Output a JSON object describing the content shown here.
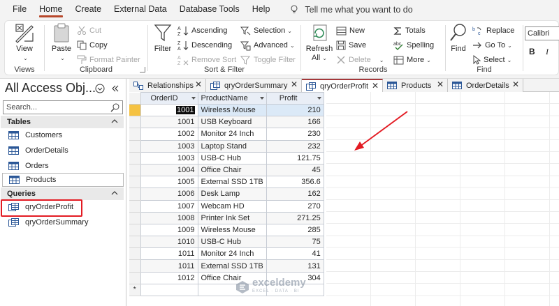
{
  "menu": {
    "items": [
      "File",
      "Home",
      "Create",
      "External Data",
      "Database Tools",
      "Help"
    ],
    "active": "Home",
    "tell_me": "Tell me what you want to do"
  },
  "ribbon": {
    "views": {
      "view_label": "View",
      "group_label": "Views"
    },
    "clipboard": {
      "paste_label": "Paste",
      "cut_label": "Cut",
      "copy_label": "Copy",
      "format_painter_label": "Format Painter",
      "group_label": "Clipboard"
    },
    "sort_filter": {
      "filter_label": "Filter",
      "ascending_label": "Ascending",
      "descending_label": "Descending",
      "remove_sort_label": "Remove Sort",
      "selection_label": "Selection",
      "advanced_label": "Advanced",
      "toggle_filter_label": "Toggle Filter",
      "group_label": "Sort & Filter"
    },
    "records": {
      "refresh_label": "Refresh",
      "refresh_sub": "All",
      "new_label": "New",
      "save_label": "Save",
      "delete_label": "Delete",
      "totals_label": "Totals",
      "spelling_label": "Spelling",
      "more_label": "More",
      "group_label": "Records"
    },
    "find": {
      "find_label": "Find",
      "replace_label": "Replace",
      "goto_label": "Go To",
      "select_label": "Select",
      "group_label": "Find"
    },
    "text_formatting": {
      "font_value": "Calibri",
      "bold_label": "B",
      "italic_label": "I"
    }
  },
  "nav": {
    "title": "All Access Obj...",
    "search_placeholder": "Search...",
    "tables_header": "Tables",
    "tables": [
      "Customers",
      "OrderDetails",
      "Orders",
      "Products"
    ],
    "selected_table": "Products",
    "queries_header": "Queries",
    "queries": [
      "qryOrderProfit",
      "qryOrderSummary"
    ]
  },
  "doc_tabs": [
    {
      "label": "Relationships",
      "icon": "relationships-icon",
      "active": false
    },
    {
      "label": "qryOrderSummary",
      "icon": "query-icon",
      "active": false
    },
    {
      "label": "qryOrderProfit",
      "icon": "query-icon",
      "active": true
    },
    {
      "label": "Products",
      "icon": "table-icon",
      "active": false
    },
    {
      "label": "OrderDetails",
      "icon": "table-icon",
      "active": false
    }
  ],
  "datasheet": {
    "columns": [
      "OrderID",
      "ProductName",
      "Profit"
    ],
    "rows": [
      [
        "1001",
        "Wireless Mouse",
        "210"
      ],
      [
        "1001",
        "USB Keyboard",
        "166"
      ],
      [
        "1002",
        "Monitor 24 Inch",
        "230"
      ],
      [
        "1003",
        "Laptop Stand",
        "232"
      ],
      [
        "1003",
        "USB-C Hub",
        "121.75"
      ],
      [
        "1004",
        "Office Chair",
        "45"
      ],
      [
        "1005",
        "External SSD 1TB",
        "356.6"
      ],
      [
        "1006",
        "Desk Lamp",
        "162"
      ],
      [
        "1007",
        "Webcam HD",
        "270"
      ],
      [
        "1008",
        "Printer Ink Set",
        "271.25"
      ],
      [
        "1009",
        "Wireless Mouse",
        "285"
      ],
      [
        "1010",
        "USB-C Hub",
        "75"
      ],
      [
        "1011",
        "Monitor 24 Inch",
        "41"
      ],
      [
        "1011",
        "External SSD 1TB",
        "131"
      ],
      [
        "1012",
        "Office Chair",
        "304"
      ]
    ],
    "new_row_marker": "*"
  },
  "watermark": {
    "title": "exceldemy",
    "subtitle": "EXCEL · DATA · BI"
  },
  "colors": {
    "accent": "#b7472a",
    "highlight_red": "#e31b23",
    "arrow_red": "#e31b23",
    "current_row_selector": "#f5c242"
  }
}
